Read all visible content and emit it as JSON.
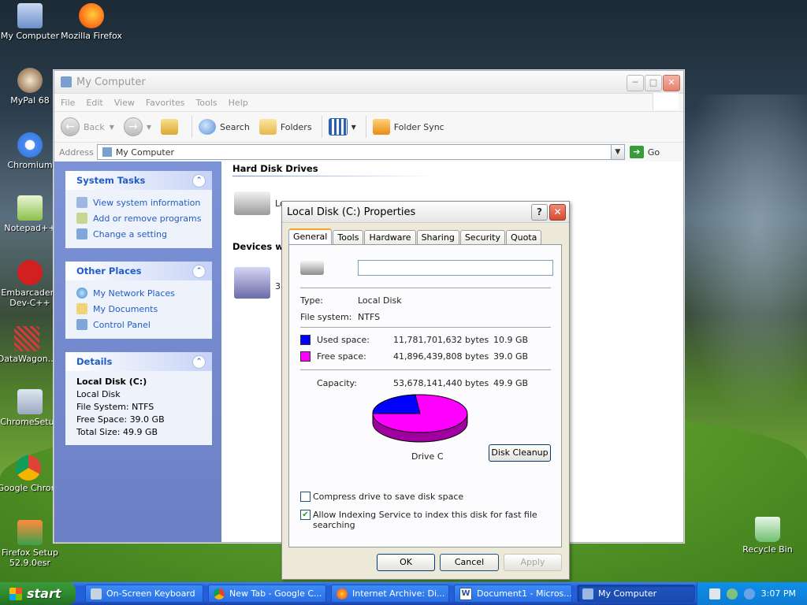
{
  "desktop": {
    "icons": [
      {
        "label": "My Computer"
      },
      {
        "label": "Mozilla Firefox"
      },
      {
        "label": "MyPal 68"
      },
      {
        "label": "Chromium"
      },
      {
        "label": "Notepad++"
      },
      {
        "label": "Embarcadero Dev-C++"
      },
      {
        "label": "DataWagon..."
      },
      {
        "label": "ChromeSetup"
      },
      {
        "label": "Google Chrom"
      },
      {
        "label": "Firefox Setup 52.9.0esr"
      },
      {
        "label": "Recycle Bin"
      }
    ]
  },
  "explorer": {
    "title": "My Computer",
    "menu": [
      "File",
      "Edit",
      "View",
      "Favorites",
      "Tools",
      "Help"
    ],
    "toolbar": {
      "back": "Back",
      "search": "Search",
      "folders": "Folders",
      "folder_sync": "Folder Sync"
    },
    "address": {
      "label": "Address",
      "value": "My Computer",
      "go": "Go"
    },
    "system_tasks": {
      "title": "System Tasks",
      "items": [
        "View system information",
        "Add or remove programs",
        "Change a setting"
      ]
    },
    "other_places": {
      "title": "Other Places",
      "items": [
        "My Network Places",
        "My Documents",
        "Control Panel"
      ]
    },
    "details": {
      "title": "Details",
      "name": "Local Disk (C:)",
      "type": "Local Disk",
      "file_system": "File System: NTFS",
      "free_space": "Free Space: 39.0 GB",
      "total_size": "Total Size: 49.9 GB"
    },
    "sections": {
      "hard_disks": "Hard Disk Drives",
      "devices": "Devices wit"
    },
    "items": {
      "local_disk_partial": "Lo",
      "floppy_partial": "3"
    }
  },
  "dialog": {
    "title": "Local Disk (C:) Properties",
    "tabs": [
      "General",
      "Tools",
      "Hardware",
      "Sharing",
      "Security",
      "Quota"
    ],
    "label_value": "",
    "type_label": "Type:",
    "type_value": "Local Disk",
    "fs_label": "File system:",
    "fs_value": "NTFS",
    "used_label": "Used space:",
    "used_bytes": "11,781,701,632 bytes",
    "used_gb": "10.9 GB",
    "free_label": "Free space:",
    "free_bytes": "41,896,439,808 bytes",
    "free_gb": "39.0 GB",
    "capacity_label": "Capacity:",
    "capacity_bytes": "53,678,141,440 bytes",
    "capacity_gb": "49.9 GB",
    "drive_label": "Drive C",
    "disk_cleanup": "Disk Cleanup",
    "compress_label": "Compress drive to save disk space",
    "compress_checked": false,
    "index_label": "Allow Indexing Service to index this disk for fast file searching",
    "index_checked": true,
    "ok": "OK",
    "cancel": "Cancel",
    "apply": "Apply",
    "colors": {
      "used": "#0000ff",
      "free": "#ff00ff"
    }
  },
  "taskbar": {
    "start": "start",
    "tasks": [
      {
        "label": "On-Screen Keyboard"
      },
      {
        "label": "New Tab - Google C..."
      },
      {
        "label": "Internet Archive: Di..."
      },
      {
        "label": "Document1 - Micros..."
      },
      {
        "label": "My Computer"
      }
    ],
    "clock": "3:07 PM"
  }
}
